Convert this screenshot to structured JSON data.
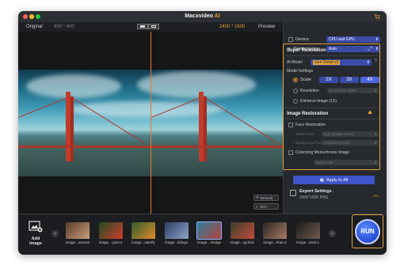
{
  "app": {
    "title": "Macxvideo",
    "title_accent": "AI"
  },
  "previewbar": {
    "original_label": "Original",
    "original_res": "600 * 400",
    "output_res": "2400 * 1600",
    "preview_label": "Preview"
  },
  "panel": {
    "device_label": "Device",
    "device_value": "CPU and GPU",
    "deinterlacing_label": "Deinterlacing",
    "deinterlacing_value": "Auto",
    "super_resolution": "Super Resolution",
    "ai_model_label": "AI Model",
    "ai_model_value": "Gen Detail v3",
    "model_settings_label": "Model Settings",
    "scale_label": "Scale",
    "scales": [
      "2X",
      "3X",
      "4X"
    ],
    "resolution_label": "Resolution",
    "resolution_value": "4K (4096 X 4096)",
    "enhance_label": "Enhance Image (1X)",
    "image_restoration": "Image Restoration",
    "face_restoration_label": "Face Restoration",
    "select_face_label": "Select Face",
    "select_face_value": "High Quality Faces",
    "background_label": "Background Face",
    "background_value": "Gradient Overlay",
    "colorizing_label": "Colorizing Monochrome Image",
    "colorizing_value": "HyperColor",
    "apply_label": "Apply to All",
    "export_title": "Export Settings",
    "export_sub": "2400*1600 PNG"
  },
  "preview_tools": {
    "refresh": "Refresh",
    "zoom": "75%"
  },
  "bottom": {
    "add_image": "Add Image",
    "thumbs": [
      {
        "caption": "image...woman",
        "c1": "#5a3b2a",
        "c2": "#caa07a"
      },
      {
        "caption": "image...-parrot",
        "c1": "#1e4d24",
        "c2": "#d13b2b"
      },
      {
        "caption": "image...utterfly",
        "c1": "#2d5d2e",
        "c2": "#e08a2a"
      },
      {
        "caption": "image...ildings",
        "c1": "#2b3f66",
        "c2": "#8fa3c7"
      },
      {
        "caption": "image...-bridge",
        "c1": "#2f7fa0",
        "c2": "#b3413a"
      },
      {
        "caption": "image...ng-bird",
        "c1": "#3a3f2a",
        "c2": "#c44b3c"
      },
      {
        "caption": "image...rtrait-2",
        "c1": "#2a2624",
        "c2": "#a67a63"
      },
      {
        "caption": "image...rtrait-1",
        "c1": "#1f1d1c",
        "c2": "#6d5a4f"
      }
    ],
    "run_label": "RUN"
  }
}
